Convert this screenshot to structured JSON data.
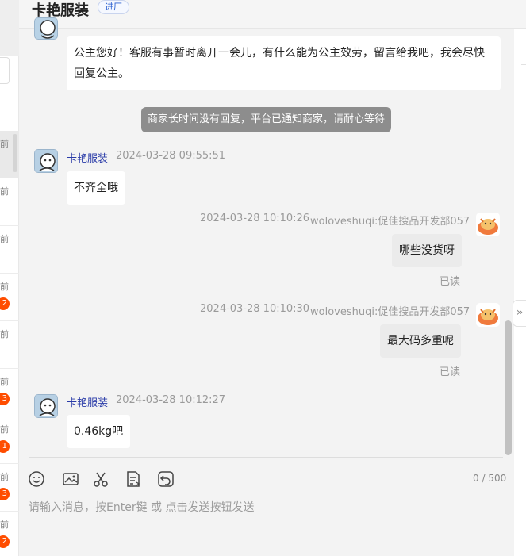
{
  "header": {
    "shop_name": "卡艳服装",
    "shop_tag": "进厂"
  },
  "sidebar": {
    "items": [
      {
        "time": "前",
        "badge": ""
      },
      {
        "time": "前",
        "badge": ""
      },
      {
        "time": "前",
        "badge": ""
      },
      {
        "time": "前",
        "badge": "2"
      },
      {
        "time": "前",
        "badge": ""
      },
      {
        "time": "前",
        "badge": "3"
      },
      {
        "time": "前",
        "badge": "1"
      },
      {
        "time": "前",
        "badge": "3"
      },
      {
        "time": "前",
        "badge": "2"
      }
    ]
  },
  "messages": {
    "auto_reply": "公主您好！客服有事暂时离开一会儿，有什么能为公主效劳，留言给我吧，我会尽快回复公主。",
    "system_notice": "商家长时间没有回复，平台已通知商家，请耐心等待",
    "m1": {
      "name": "卡艳服装",
      "time": "2024-03-28 09:55:51",
      "text": "不齐全哦"
    },
    "m2": {
      "time": "2024-03-28 10:10:26",
      "name": "woloveshuqi:促佳搜品开发部057",
      "text": "哪些没货呀",
      "status": "已读"
    },
    "m3": {
      "time": "2024-03-28 10:10:30",
      "name": "woloveshuqi:促佳搜品开发部057",
      "text": "最大码多重呢",
      "status": "已读"
    },
    "m4": {
      "name": "卡艳服装",
      "time": "2024-03-28 10:12:27",
      "text": "0.46kg吧"
    }
  },
  "composer": {
    "counter": "0 / 500",
    "placeholder": "请输入消息，按Enter键 或 点击发送按钮发送",
    "tools": [
      "emoji-icon",
      "image-icon",
      "scissors-icon",
      "quick-phrase-icon",
      "history-icon"
    ]
  },
  "colors": {
    "accent_blue": "#2a3ba8",
    "badge_red": "#ff4d00",
    "system_gray": "#8d8d8d"
  }
}
